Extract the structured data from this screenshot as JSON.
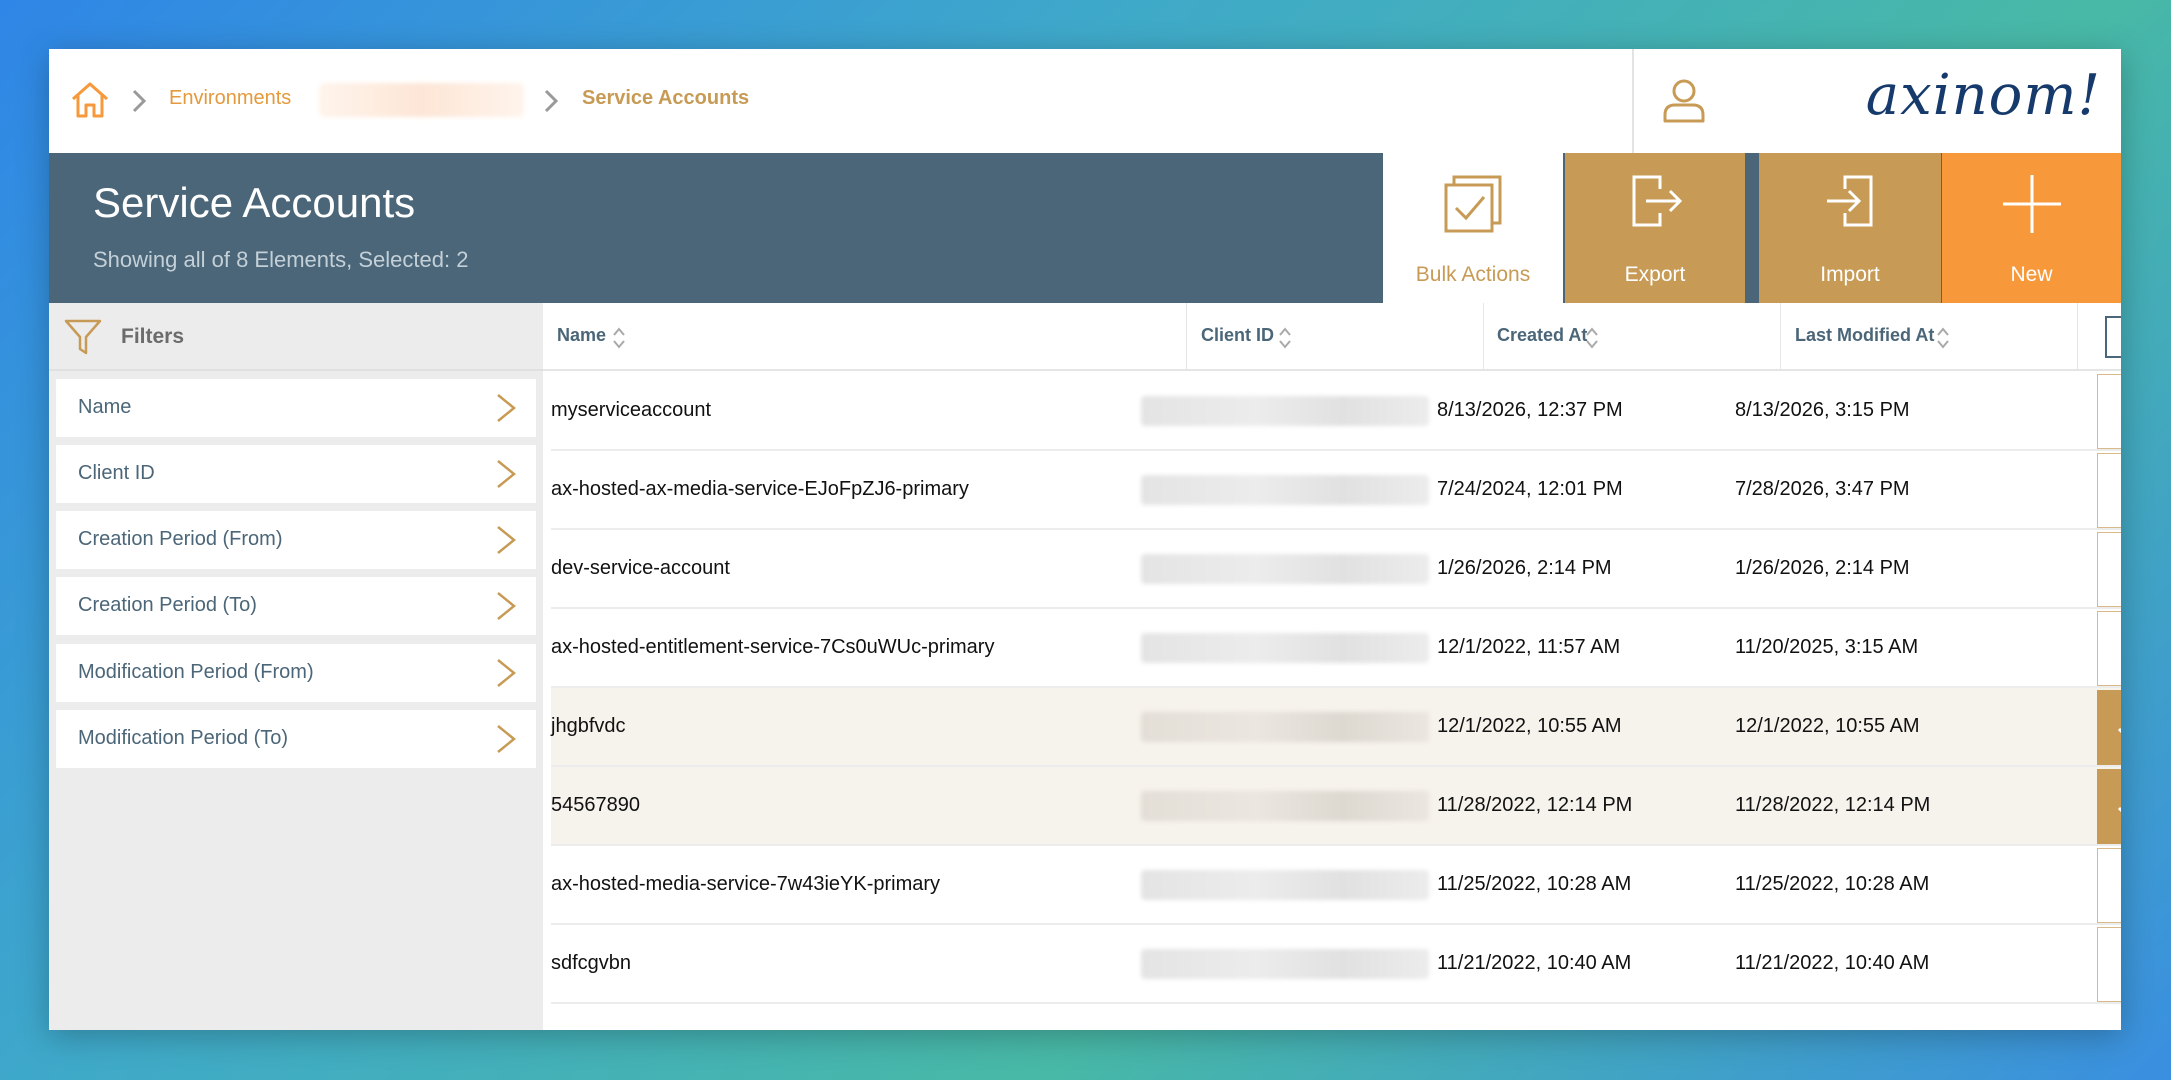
{
  "breadcrumb": {
    "items": [
      "Environments",
      "Service Accounts"
    ]
  },
  "brand": {
    "logo_text": "axinom!"
  },
  "header": {
    "title": "Service Accounts",
    "subtitle": "Showing all of 8 Elements, Selected: 2"
  },
  "actions": {
    "bulk": "Bulk Actions",
    "export": "Export",
    "import": "Import",
    "new": "New"
  },
  "filters": {
    "title": "Filters",
    "items": [
      "Name",
      "Client ID",
      "Creation Period (From)",
      "Creation Period (To)",
      "Modification Period (From)",
      "Modification Period (To)"
    ]
  },
  "table": {
    "columns": [
      "Name",
      "Client ID",
      "Created At",
      "Last Modified At"
    ],
    "rows": [
      {
        "name": "myserviceaccount",
        "created": "8/13/2026, 12:37 PM",
        "modified": "8/13/2026, 3:15 PM",
        "selected": false
      },
      {
        "name": "ax-hosted-ax-media-service-EJoFpZJ6-primary",
        "created": "7/24/2024, 12:01 PM",
        "modified": "7/28/2026, 3:47 PM",
        "selected": false
      },
      {
        "name": "dev-service-account",
        "created": "1/26/2026, 2:14 PM",
        "modified": "1/26/2026, 2:14 PM",
        "selected": false
      },
      {
        "name": "ax-hosted-entitlement-service-7Cs0uWUc-primary",
        "created": "12/1/2022, 11:57 AM",
        "modified": "11/20/2025, 3:15 AM",
        "selected": false
      },
      {
        "name": "jhgbfvdc",
        "created": "12/1/2022, 10:55 AM",
        "modified": "12/1/2022, 10:55 AM",
        "selected": true
      },
      {
        "name": "54567890",
        "created": "11/28/2022, 12:14 PM",
        "modified": "11/28/2022, 12:14 PM",
        "selected": true
      },
      {
        "name": "ax-hosted-media-service-7w43ieYK-primary",
        "created": "11/25/2022, 10:28 AM",
        "modified": "11/25/2022, 10:28 AM",
        "selected": false
      },
      {
        "name": "sdfcgvbn",
        "created": "11/21/2022, 10:40 AM",
        "modified": "11/21/2022, 10:40 AM",
        "selected": false
      }
    ]
  },
  "colors": {
    "accent_gold": "#c79b55",
    "accent_orange": "#f7993a",
    "header_slate": "#4b6678",
    "breadcrumb_orange": "#e49a3c"
  },
  "icons": {
    "home": "home-icon",
    "user": "user-icon",
    "filter": "filter-icon",
    "bulk": "bulk-actions-icon",
    "export": "export-icon",
    "import": "import-icon",
    "new": "plus-icon",
    "chevron": "chevron-right-icon",
    "sort": "sort-icon",
    "check": "checkmark-icon"
  }
}
